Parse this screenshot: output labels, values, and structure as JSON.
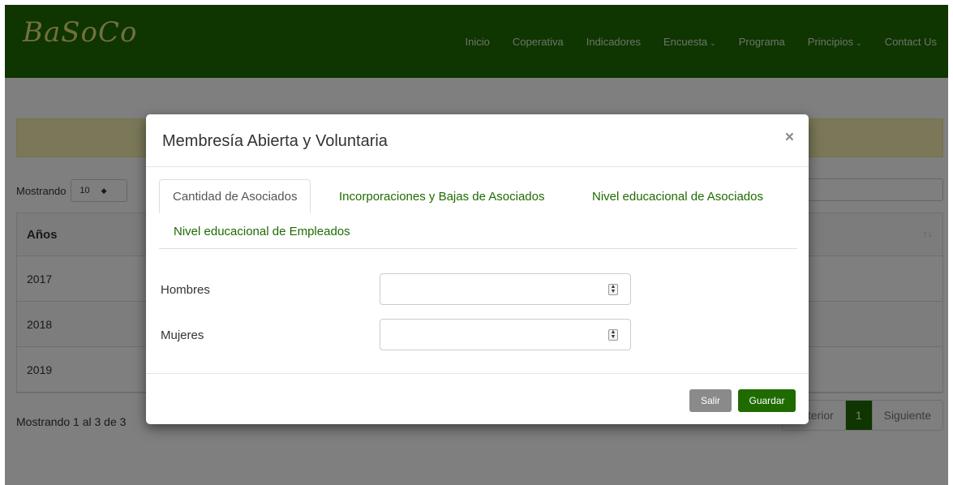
{
  "navbar": {
    "logo": "BaSoCo",
    "items": [
      {
        "label": "Inicio",
        "caret": ""
      },
      {
        "label": "Coperativa",
        "caret": ""
      },
      {
        "label": "Indicadores",
        "caret": ""
      },
      {
        "label": "Encuesta",
        "caret": "⌄"
      },
      {
        "label": "Programa",
        "caret": ""
      },
      {
        "label": "Principios",
        "caret": "⌄"
      },
      {
        "label": "Contact Us",
        "caret": ""
      }
    ]
  },
  "page": {
    "show_label": "Mostrando",
    "page_length": "10",
    "table": {
      "header": "Años",
      "rows": [
        "2017",
        "2018",
        "2019"
      ]
    },
    "info": "Mostrando 1 al 3 de 3",
    "pager": {
      "previous": "Anterior",
      "current": "1",
      "next": "Siguiente"
    }
  },
  "modal": {
    "title": "Membresía Abierta y Voluntaria",
    "close": "×",
    "tabs": [
      "Cantidad de Asociados",
      "Incorporaciones y Bajas de Asociados",
      "Nivel educacional de Asociados",
      "Nivel educacional de Empleados"
    ],
    "fields": [
      {
        "label": "Hombres",
        "value": ""
      },
      {
        "label": "Mujeres",
        "value": ""
      }
    ],
    "buttons": {
      "exit": "Salir",
      "save": "Guardar"
    }
  },
  "colors": {
    "brand_green": "#1f6b00",
    "alert_yellow": "#f5f0b0"
  }
}
